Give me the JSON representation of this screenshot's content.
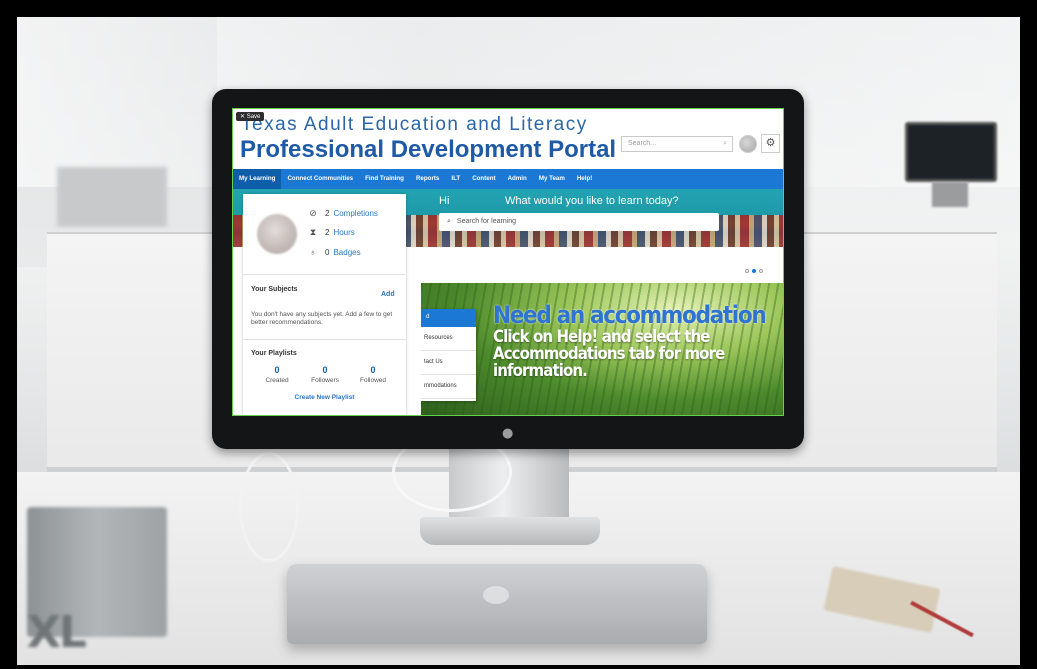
{
  "portal": {
    "save_label": "Save",
    "title_line1": "Texas Adult Education and Literacy",
    "title_line2": "Professional Development Portal",
    "search_placeholder": "Search..."
  },
  "nav": {
    "items": [
      "My Learning",
      "Connect Communities",
      "Find Training",
      "Reports",
      "ILT",
      "Content",
      "Admin",
      "My Team",
      "Help!"
    ],
    "active": "My Learning"
  },
  "banner": {
    "greeting": "Hi",
    "prompt": "What would you like to learn today?",
    "search_placeholder": "Search for learning"
  },
  "profile": {
    "stats": [
      {
        "icon": "completions-icon",
        "value": "2",
        "label": "Completions"
      },
      {
        "icon": "hours-icon",
        "value": "2",
        "label": "Hours"
      },
      {
        "icon": "badges-icon",
        "value": "0",
        "label": "Badges"
      }
    ],
    "subjects_title": "Your Subjects",
    "subjects_add": "Add",
    "subjects_text": "You don't have any subjects yet. Add a few to get better recommendations.",
    "playlists_title": "Your Playlists",
    "playlists": [
      {
        "value": "0",
        "label": "Created"
      },
      {
        "value": "0",
        "label": "Followers"
      },
      {
        "value": "0",
        "label": "Followed"
      }
    ],
    "create_playlist": "Create New Playlist"
  },
  "promo": {
    "headline": "Need an accommodation",
    "body_line1": "Click on Help! and select the",
    "body_line2": "Accommodations tab for more",
    "body_line3": "information.",
    "menu_items": [
      "Resources",
      "tact Us",
      "mmodations"
    ]
  },
  "scene": {
    "book_text": "XL",
    "apple_logo": ""
  },
  "colors": {
    "nav_blue": "#1b78d4",
    "title_blue": "#1f5aa6",
    "link_blue": "#2a76c6",
    "banner_teal": "#23a3b3"
  }
}
